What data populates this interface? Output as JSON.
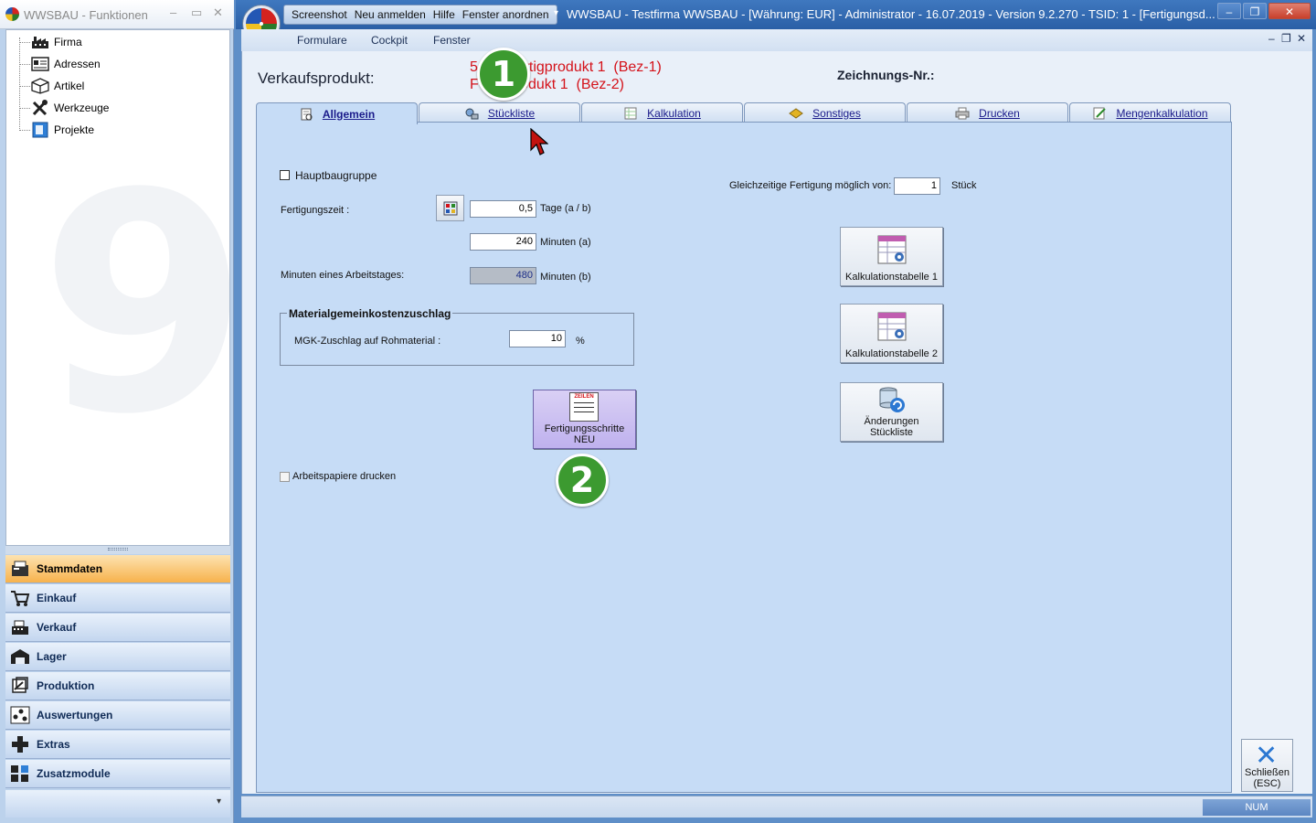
{
  "left_panel": {
    "title": "WWSBAU - Funktionen",
    "tree": [
      {
        "label": "Firma",
        "icon": "factory-icon"
      },
      {
        "label": "Adressen",
        "icon": "address-card-icon"
      },
      {
        "label": "Artikel",
        "icon": "box-icon"
      },
      {
        "label": "Werkzeuge",
        "icon": "tools-icon"
      },
      {
        "label": "Projekte",
        "icon": "project-icon"
      }
    ],
    "nav": [
      {
        "label": "Stammdaten",
        "icon": "master-data-icon",
        "active": true
      },
      {
        "label": "Einkauf",
        "icon": "cart-icon"
      },
      {
        "label": "Verkauf",
        "icon": "cash-register-icon"
      },
      {
        "label": "Lager",
        "icon": "warehouse-icon"
      },
      {
        "label": "Produktion",
        "icon": "production-icon"
      },
      {
        "label": "Auswertungen",
        "icon": "analytics-icon"
      },
      {
        "label": "Extras",
        "icon": "extras-icon"
      },
      {
        "label": "Zusatzmodule",
        "icon": "modules-icon"
      }
    ],
    "more": "▾"
  },
  "titlebar": {
    "quick_access": [
      "Screenshot",
      "Neu anmelden",
      "Hilfe",
      "Fenster anordnen"
    ],
    "title": "WWSBAU - Testfirma WWSBAU - [Währung: EUR] - Administrator - 16.07.2019 - Version 9.2.270 - TSID: 1  - [Fertigungsd..."
  },
  "menu": [
    "Formulare",
    "Cockpit",
    "Fenster"
  ],
  "header": {
    "label": "Verkaufsprodukt:",
    "line1": "5     - Fertigprodukt 1  (Bez-1)",
    "line2": "F         rodukt 1  (Bez-2)",
    "zeichnung_label": "Zeichnungs-Nr.:"
  },
  "tabs": [
    {
      "label": "Allgemein",
      "icon": "document-icon",
      "active": true
    },
    {
      "label": "Stückliste",
      "icon": "parts-list-icon"
    },
    {
      "label": "Kalkulation",
      "icon": "calculation-icon"
    },
    {
      "label": "Sonstiges",
      "icon": "misc-icon"
    },
    {
      "label": "Drucken",
      "icon": "printer-icon"
    },
    {
      "label": "Mengenkalkulation",
      "icon": "quantity-calc-icon"
    }
  ],
  "form": {
    "hauptbaugruppe": "Hauptbaugruppe",
    "fertigungszeit_label": "Fertigungszeit :",
    "tage_value": "0,5",
    "tage_unit": "Tage (a / b)",
    "minuten_value": "240",
    "minuten_unit": "Minuten (a)",
    "arbeitstag_label": "Minuten eines Arbeitstages:",
    "arbeitstag_value": "480",
    "arbeitstag_unit": "Minuten (b)",
    "mgk_group": "Materialgemeinkostenzuschlag",
    "mgk_label": "MGK-Zuschlag auf Rohmaterial :",
    "mgk_value": "10",
    "mgk_unit": "%",
    "fert_btn_line1": "Fertigungsschritte",
    "fert_btn_line2": "NEU",
    "fert_btn_icon_text": "ZEILEN",
    "arbeitspapiere": "Arbeitspapiere drucken",
    "gleichzeitig_label": "Gleichzeitige Fertigung möglich von:",
    "gleichzeitig_value": "1",
    "gleichzeitig_unit": "Stück",
    "kalk1": "Kalkulationstabelle 1",
    "kalk2": "Kalkulationstabelle 2",
    "aend_line1": "Änderungen",
    "aend_line2": "Stückliste"
  },
  "callouts": [
    "1",
    "2"
  ],
  "close": {
    "line1": "Schließen",
    "line2": "(ESC)"
  },
  "status": {
    "num": "NUM"
  },
  "colors": {
    "accent": "#d4121a",
    "callout": "#3c9a30",
    "panel": "#c6dcf6"
  }
}
